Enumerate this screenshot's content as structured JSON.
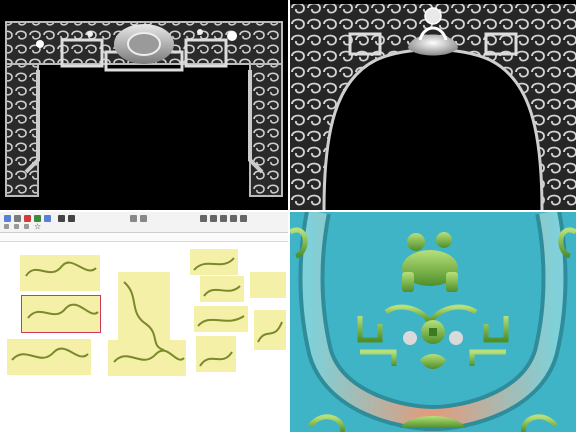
{
  "panels": {
    "top_left": {
      "kind": "render",
      "description_icon": "carved-arch-grayscale"
    },
    "top_right": {
      "kind": "render",
      "description_icon": "carved-arch-grayscale-lotus"
    },
    "bottom_left": {
      "kind": "editor",
      "toolbar_icons": [
        "select-icon",
        "move-icon",
        "rotate-icon",
        "scale-icon",
        "zoom-icon",
        "pan-icon",
        "cut-icon",
        "copy-icon",
        "paste-icon",
        "undo-icon",
        "redo-icon",
        "layer-icon",
        "align-icon",
        "grid-icon",
        "star-icon"
      ]
    },
    "bottom_right": {
      "kind": "relief-render",
      "description_icon": "colored-relief-panel"
    }
  },
  "colors": {
    "tile_bg": "#f4f0a8",
    "relief_bg": "#3fb4c6",
    "relief_frame": "#d68a6c",
    "carving_green": "#7fb64a",
    "selection": "#d03a5a"
  }
}
